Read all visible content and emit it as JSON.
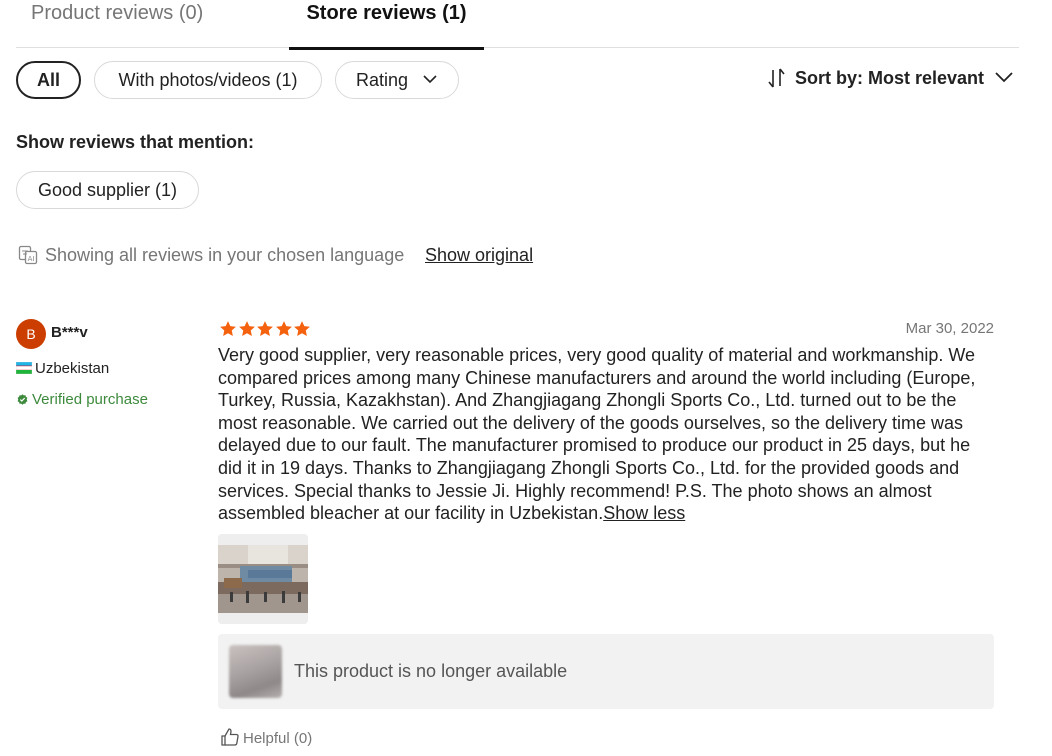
{
  "tabs": {
    "product_reviews": "Product reviews (0)",
    "store_reviews": "Store reviews (1)",
    "active": "store_reviews"
  },
  "filters": {
    "all": "All",
    "with_photos": "With photos/videos (1)",
    "rating": "Rating"
  },
  "sort": {
    "label": "Sort by: Most relevant"
  },
  "mentions": {
    "title": "Show reviews that mention:",
    "tags": [
      "Good supplier (1)"
    ]
  },
  "language": {
    "notice": "Showing all reviews in your chosen language",
    "show_original": "Show original"
  },
  "review": {
    "avatar_letter": "B",
    "name": "B***v",
    "country": "Uzbekistan",
    "verified": "Verified purchase",
    "rating": 5,
    "date": "Mar 30, 2022",
    "text": "Very good supplier, very reasonable prices, very good quality of material and workmanship. We compared prices among many Chinese manufacturers and around the world including (Europe, Turkey, Russia, Kazakhstan). And Zhangjiagang Zhongli Sports Co., Ltd. turned out to be the most reasonable. We carried out the delivery of the goods ourselves, so the delivery time was delayed due to our fault. The manufacturer promised to produce our product in 25 days, but he did it in 19 days. Thanks to Zhangjiagang Zhongli Sports Co., Ltd. for the provided goods and services. Special thanks to Jessie Ji. Highly recommend! P.S. The photo shows an almost assembled bleacher at our facility in Uzbekistan.",
    "show_less": "Show less",
    "unavailable_text": "This product is no longer available",
    "helpful": "Helpful (0)"
  },
  "colors": {
    "star": "#f5620f",
    "avatar_bg": "#cc3d00",
    "verified": "#3d8a3d",
    "muted_text": "#767676",
    "unavailable_bg": "#f2f2f2"
  }
}
